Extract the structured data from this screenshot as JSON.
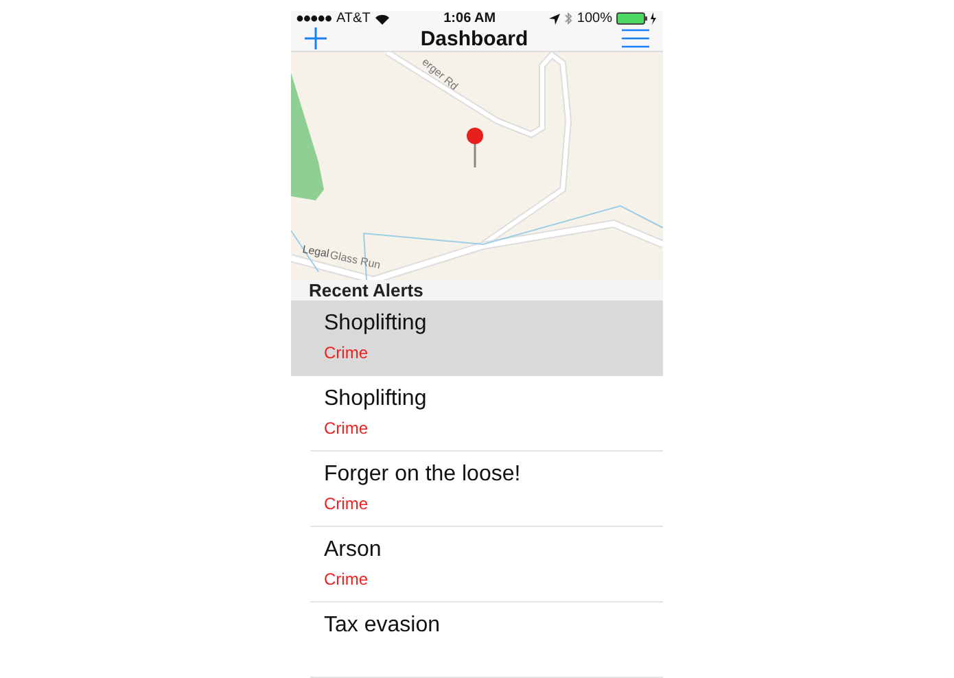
{
  "status_bar": {
    "carrier": "AT&T",
    "time": "1:06 AM",
    "battery": "100%"
  },
  "nav_bar": {
    "title": "Dashboard"
  },
  "map": {
    "labels": [
      {
        "text": "erger Rd",
        "kind": "road"
      },
      {
        "text": "Legal",
        "kind": "place"
      },
      {
        "text": "Glass Run",
        "kind": "road"
      }
    ]
  },
  "section": {
    "title": "Recent Alerts"
  },
  "alerts": [
    {
      "title": "Shoplifting",
      "category": "Crime",
      "selected": true
    },
    {
      "title": "Shoplifting",
      "category": "Crime",
      "selected": false
    },
    {
      "title": "Forger on the loose!",
      "category": "Crime",
      "selected": false
    },
    {
      "title": "Arson",
      "category": "Crime",
      "selected": false
    },
    {
      "title": "Tax evasion",
      "selected": false
    }
  ]
}
